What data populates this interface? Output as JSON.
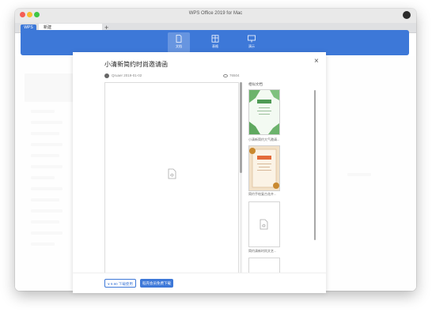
{
  "window": {
    "title": "WPS Office 2019 for Mac"
  },
  "tabs": {
    "wps_label": "WPS",
    "new_tab_label": "新建",
    "add_label": "+"
  },
  "nav": [
    {
      "label": "文档",
      "icon": "document-icon",
      "active": true
    },
    {
      "label": "表格",
      "icon": "table-icon",
      "active": false
    },
    {
      "label": "演示",
      "icon": "presentation-icon",
      "active": false
    }
  ],
  "modal": {
    "title": "小清新简约时尚邀请函",
    "close_label": "×",
    "author": "Qruaer  2019-01-02",
    "views": "76504",
    "related_heading": "相似文档",
    "related": [
      {
        "caption": "小清新简约大气邀请..."
      },
      {
        "caption": "简约手绘复古花卉..."
      },
      {
        "caption": "简约清新时尚文艺..."
      }
    ],
    "buttons": {
      "price": "¥ 9.90 下载使用",
      "member": "稻壳会员免费下载"
    }
  },
  "colors": {
    "accent": "#3d78d8"
  }
}
